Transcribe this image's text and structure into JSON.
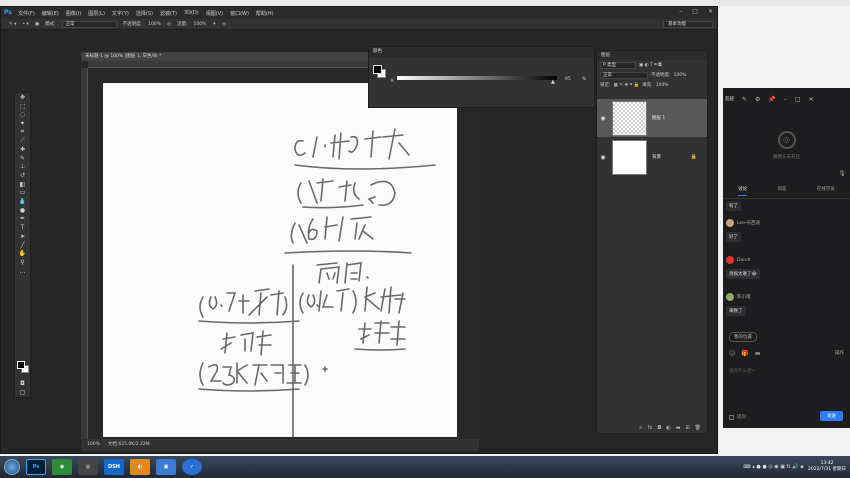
{
  "photoshop": {
    "logo": "Ps",
    "menu": [
      "文件(F)",
      "编辑(E)",
      "图像(I)",
      "图层(L)",
      "文字(Y)",
      "选择(S)",
      "滤镜(T)",
      "3D(D)",
      "视图(V)",
      "窗口(W)",
      "帮助(H)"
    ],
    "options": {
      "mode_label": "模式:",
      "mode_value": "正常",
      "opacity_label": "不透明度:",
      "opacity_value": "100%",
      "flow_label": "流量:",
      "flow_value": "100%"
    },
    "workspace": "基本功能",
    "document": {
      "tab_title": "未标题-1 @ 100% (图层 1, 灰色/8) *",
      "zoom": "100%",
      "doc_info": "文档:625.0K/2.22M"
    },
    "color_panel": {
      "title": "颜色",
      "channel": "K",
      "value": "95",
      "unit": "%"
    },
    "layers_panel": {
      "title": "图层",
      "kind_label": "P 类型",
      "blend_mode": "正常",
      "opacity_label": "不透明度:",
      "opacity_value": "100%",
      "lock_label": "锁定:",
      "fill_label": "填充:",
      "fill_value": "100%",
      "layers": [
        {
          "name": "图层 1",
          "selected": true
        },
        {
          "name": "背景",
          "selected": false
        }
      ]
    }
  },
  "chat": {
    "top_label": "超越",
    "camera_text": "摄像头未开启",
    "tabs": [
      "讨论",
      "问答",
      "在线学员"
    ],
    "messages": [
      {
        "sender": "",
        "text": "有了"
      },
      {
        "sender": "Leo-乐西迪",
        "text": "好了"
      },
      {
        "sender": "Dandr",
        "text": "则视太难了😂"
      },
      {
        "sender": "陈小雨",
        "text": "来晚了"
      }
    ],
    "my_seat": "我的位置",
    "tools_right": "操作",
    "input_placeholder": "说点什么吧~",
    "checkbox_label": "提问",
    "send_label": "发送"
  },
  "taskbar": {
    "apps": [
      "Ps",
      "",
      "",
      "DSH",
      "",
      "",
      ""
    ],
    "time": "13:42",
    "date": "2022/7/31 星期日"
  }
}
